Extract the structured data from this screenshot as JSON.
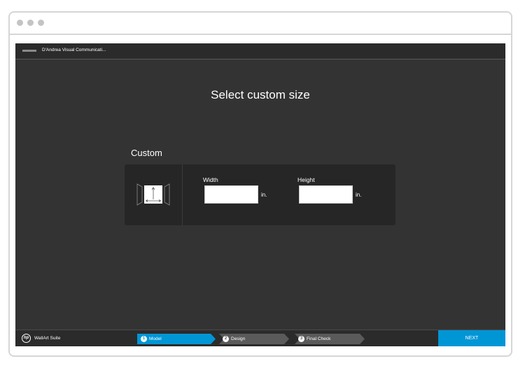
{
  "header": {
    "company": "D'Andrea Visual Communicati..."
  },
  "main": {
    "title": "Select custom size",
    "section_label": "Custom",
    "width": {
      "label": "Width",
      "value": "",
      "unit": "in."
    },
    "height": {
      "label": "Height",
      "value": "",
      "unit": "in."
    }
  },
  "footer": {
    "product": "WallArt Suite",
    "steps": [
      {
        "number": "1",
        "label": "Model",
        "active": true
      },
      {
        "number": "2",
        "label": "Design",
        "active": false
      },
      {
        "number": "3",
        "label": "Final Check",
        "active": false
      }
    ],
    "next_label": "NEXT"
  },
  "colors": {
    "accent": "#0096d6",
    "background": "#333333",
    "panel": "#262626",
    "step_inactive": "#5a5a5a"
  },
  "icons": {
    "logo": "hp-logo-icon",
    "size": "custom-size-icon"
  }
}
